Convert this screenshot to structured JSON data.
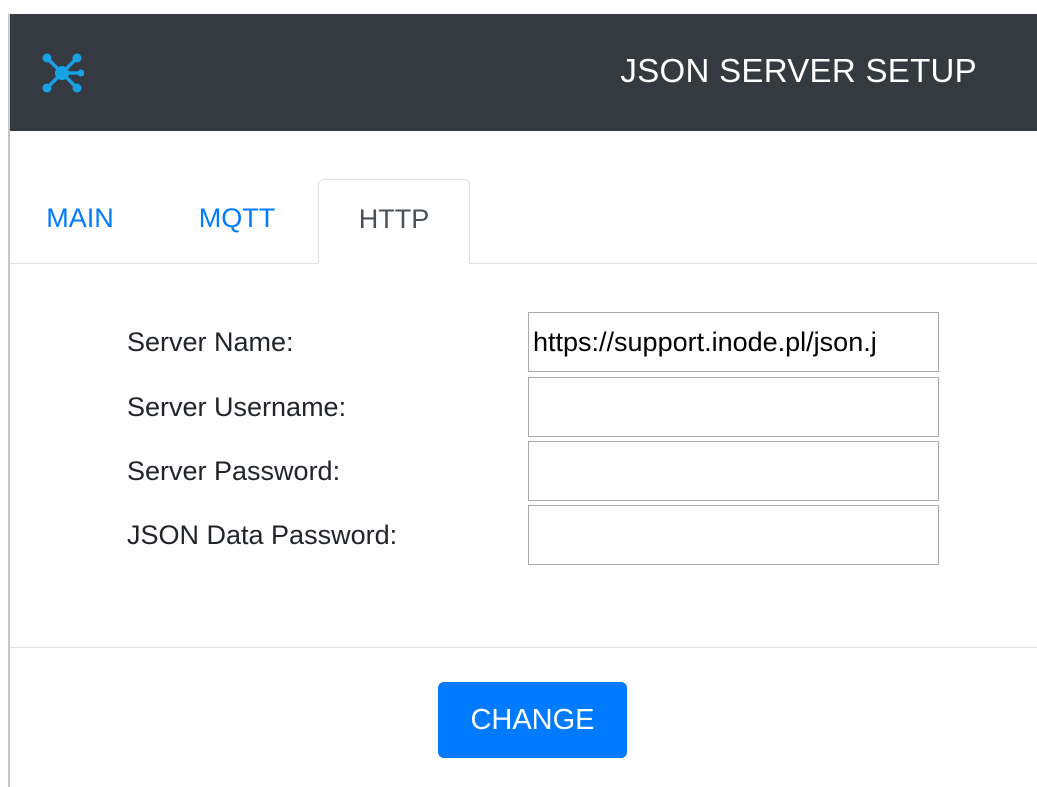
{
  "header": {
    "title": "JSON SERVER SETUP",
    "logo_icon": "network-hub-icon",
    "background_color": "#343a40",
    "logo_color": "#17a2e6"
  },
  "tabs": [
    {
      "label": "MAIN",
      "active": false
    },
    {
      "label": "MQTT",
      "active": false
    },
    {
      "label": "HTTP",
      "active": true
    }
  ],
  "form": {
    "fields": [
      {
        "label": "Server Name:",
        "value": "https://support.inode.pl/json.j"
      },
      {
        "label": "Server Username:",
        "value": ""
      },
      {
        "label": "Server Password:",
        "value": ""
      },
      {
        "label": "JSON Data Password:",
        "value": ""
      }
    ]
  },
  "actions": {
    "change_label": "CHANGE",
    "accent_color": "#007bff"
  }
}
